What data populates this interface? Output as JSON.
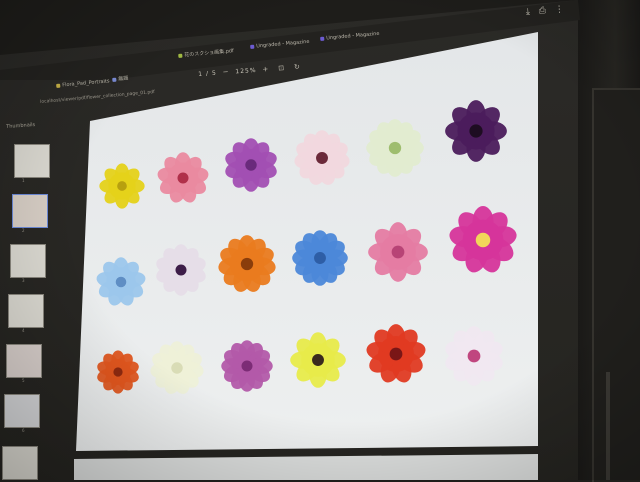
{
  "tabs": [
    {
      "label": "Flora_Pad_Portraits",
      "color": "#c9b347"
    },
    {
      "label": "無題",
      "color": "#7a8bd4"
    },
    {
      "label": "花のスクショ画集.pdf",
      "color": "#9fb842"
    },
    {
      "label": "Ungraded - Magazine",
      "color": "#6c5bd1"
    },
    {
      "label": "Ungraded - Magazine",
      "color": "#6c5bd1"
    }
  ],
  "url": "localhost/viewer/pdf/flower_collection_page_01.pdf",
  "sidebar_label": "Thumbnails",
  "toolbar": {
    "page": "1",
    "total": "/ 5",
    "zoom": "125%"
  },
  "thumbnails": [
    "1",
    "2",
    "3",
    "4",
    "5",
    "6",
    "7"
  ],
  "flowers": [
    {
      "name": "yellow-daisy",
      "color": "#e5d21a",
      "center": "#b7a00f"
    },
    {
      "name": "pink-gerbera",
      "color": "#ea8aa0",
      "center": "#b0304a"
    },
    {
      "name": "purple-lily",
      "color": "#a24fb3",
      "center": "#6a2a7c"
    },
    {
      "name": "white-anemone",
      "color": "#f1d8de",
      "center": "#6b2a3a"
    },
    {
      "name": "white-lily",
      "color": "#e2ecd0",
      "center": "#9ebd6e"
    },
    {
      "name": "purple-petunia",
      "color": "#4b1c5c",
      "center": "#1e0d22"
    },
    {
      "name": "blue-flower",
      "color": "#9cc7ec",
      "center": "#5f8ec4"
    },
    {
      "name": "purple-pansy",
      "color": "#e6dde8",
      "center": "#3d1d48"
    },
    {
      "name": "orange-gerbera",
      "color": "#ea7b1f",
      "center": "#8a3d0b"
    },
    {
      "name": "blue-hydrangea",
      "color": "#4c88d9",
      "center": "#2e5ea6"
    },
    {
      "name": "pink-carnation",
      "color": "#e57ca3",
      "center": "#b84476"
    },
    {
      "name": "magenta-vinca",
      "color": "#d6359b",
      "center": "#f2d65a"
    },
    {
      "name": "orange-poppy",
      "color": "#e0561f",
      "center": "#8e2a10"
    },
    {
      "name": "white-chrysanthemum",
      "color": "#eef0d8",
      "center": "#d9dcb6"
    },
    {
      "name": "purple-phlox",
      "color": "#b35aa9",
      "center": "#7c2c76"
    },
    {
      "name": "yellow-pansy",
      "color": "#e8eb4a",
      "center": "#3a2a1e"
    },
    {
      "name": "red-poppy",
      "color": "#e03a22",
      "center": "#7a1616"
    },
    {
      "name": "white-orchid",
      "color": "#f0e8f0",
      "center": "#c0467f"
    }
  ]
}
